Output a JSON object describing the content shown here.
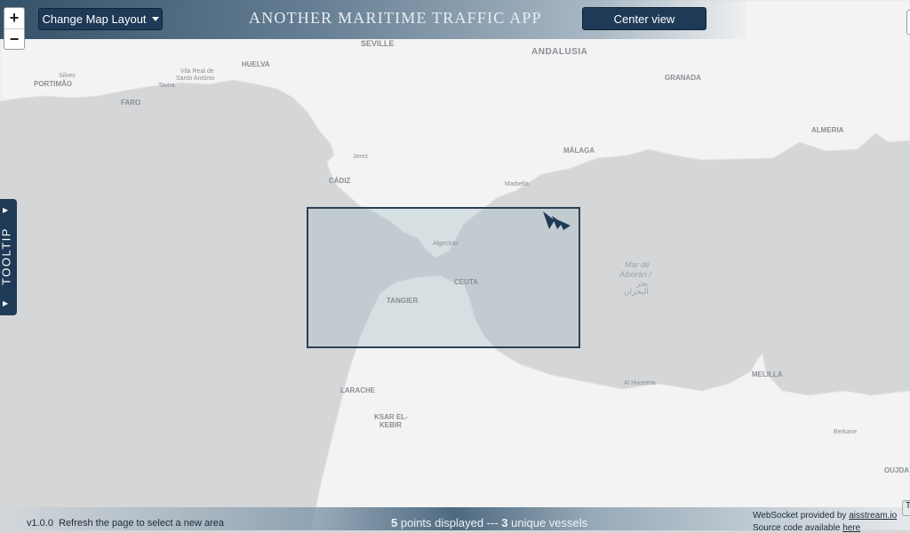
{
  "header": {
    "title": "ANOTHER MARITIME TRAFFIC APP",
    "layout_button": "Change Map Layout",
    "center_button": "Center view"
  },
  "zoom": {
    "in": "+",
    "out": "−"
  },
  "tooltip_tab": {
    "label": "TOOLTIP"
  },
  "map": {
    "labels": {
      "seville": "SEVILLE",
      "andalusia": "ANDALUSIA",
      "huelva": "HUELVA",
      "silves": "Silves",
      "portimao": "PORTIMÃO",
      "vila_real_1": "Vila Real de",
      "vila_real_2": "Santo António",
      "tavira": "Tavira",
      "faro": "FARO",
      "granada": "GRANADA",
      "almeria": "ALMERIA",
      "jerez": "Jerez",
      "cadiz": "CÁDIZ",
      "malaga": "MÁLAGA",
      "marbella": "Marbella",
      "algeciras": "Algeciras",
      "ceuta": "CEUTA",
      "tangier": "TANGIER",
      "alboran_1": "Mar de",
      "alboran_2": "Alborán /",
      "alboran_3": "بحر",
      "alboran_4": "البحران",
      "larache": "LARACHE",
      "ksar_1": "KSAR EL-",
      "ksar_2": "KEBIR",
      "al_hoceima": "Al Hoceima",
      "melilla": "MELILLA",
      "berkane": "Berkane",
      "oujda": "OUJDA"
    },
    "colors": {
      "sea": "#d4d6d8",
      "land": "#f3f3f3",
      "selection_stroke": "#2b3f52",
      "vessel": "#1e3a56"
    }
  },
  "footer": {
    "version": "v1.0.0",
    "refresh_note": "Refresh the page to select a new area",
    "points_count": "5",
    "points_text": " points displayed --- ",
    "vessels_count": "3",
    "vessels_text": " unique vessels",
    "ws_prefix": "WebSocket provided by ",
    "ws_link": "aisstream.io",
    "source_prefix": "Source code available ",
    "source_link": "here"
  }
}
